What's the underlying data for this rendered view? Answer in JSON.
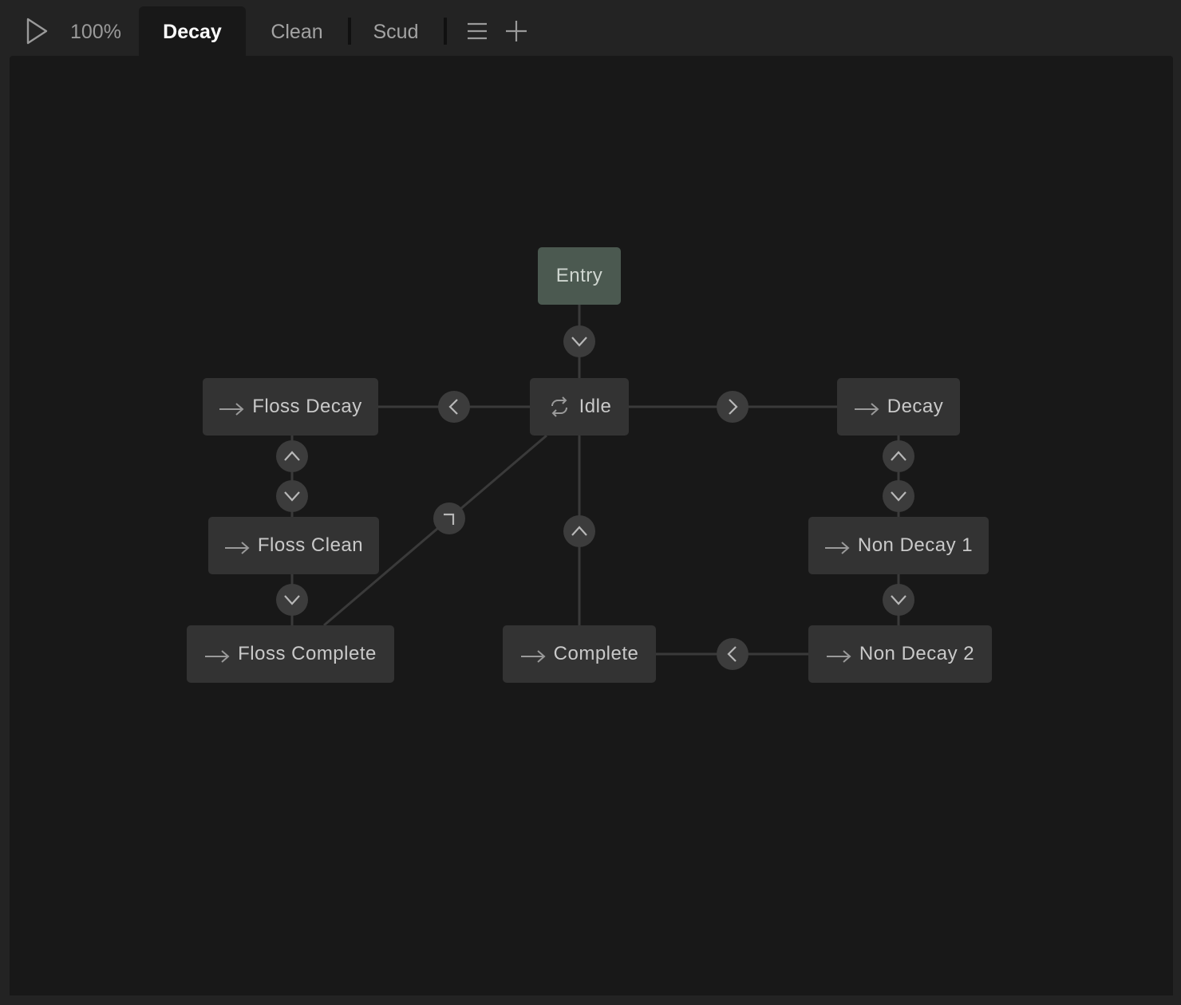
{
  "toolbar": {
    "zoom": "100%",
    "tabs": [
      {
        "label": "Decay",
        "active": true
      },
      {
        "label": "Clean",
        "active": false
      },
      {
        "label": "Scud",
        "active": false
      }
    ]
  },
  "graph": {
    "entry": "Entry",
    "idle": "Idle",
    "floss_decay": "Floss Decay",
    "floss_clean": "Floss Clean",
    "floss_complete": "Floss Complete",
    "complete": "Complete",
    "decay": "Decay",
    "non_decay_1": "Non Decay 1",
    "non_decay_2": "Non Decay 2"
  },
  "colors": {
    "canvas": "#181818",
    "node": "#333333",
    "entry_node": "#4b5950",
    "edge": "#3a3a3a",
    "badge": "#3c3c3c"
  }
}
